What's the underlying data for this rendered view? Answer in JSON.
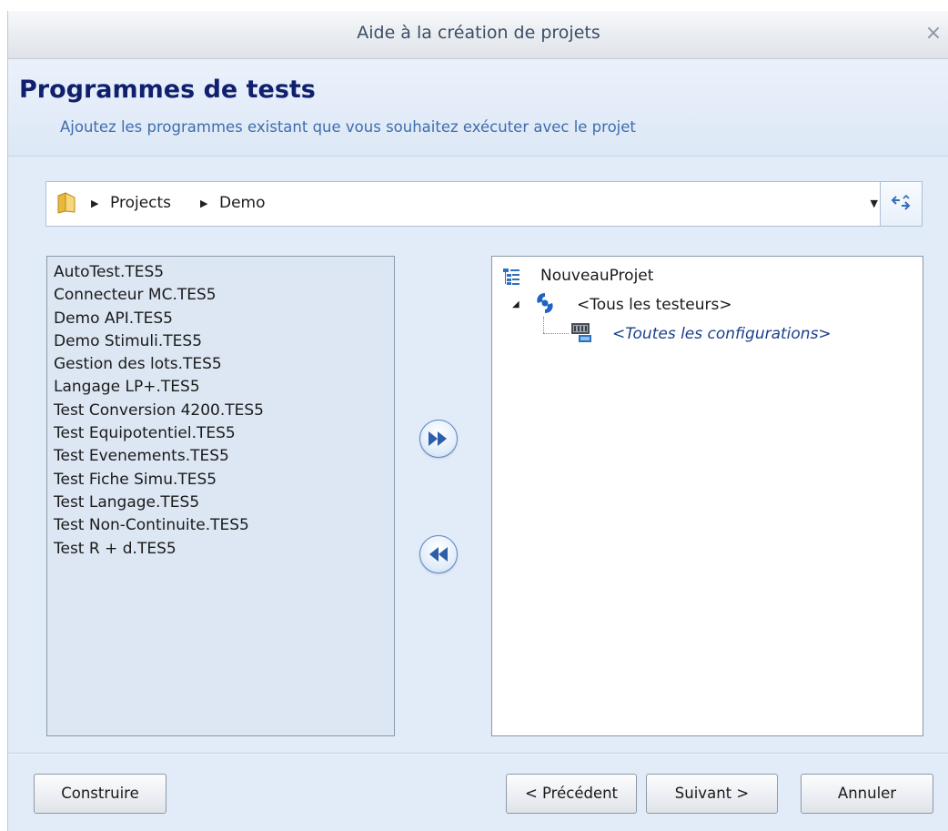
{
  "window": {
    "title": "Aide à la création de projets",
    "close_glyph": "×"
  },
  "header": {
    "title": "Programmes de tests",
    "subtitle": "Ajoutez les programmes existant que vous souhaitez exécuter avec le projet"
  },
  "path": {
    "icon": "folder-icon",
    "crumbs": [
      "Projects",
      "Demo"
    ],
    "refresh_icon": "refresh-icon"
  },
  "available_programs": [
    "AutoTest.TES5",
    "Connecteur MC.TES5",
    "Demo API.TES5",
    "Demo Stimuli.TES5",
    "Gestion des lots.TES5",
    "Langage LP+.TES5",
    "Test Conversion 4200.TES5",
    "Test Equipotentiel.TES5",
    "Test Evenements.TES5",
    "Test Fiche Simu.TES5",
    "Test Langage.TES5",
    "Test Non-Continuite.TES5",
    "Test R + d.TES5"
  ],
  "move_buttons": {
    "add_icon": "fast-forward-icon",
    "remove_icon": "rewind-icon"
  },
  "project_tree": {
    "root": {
      "label": "NouveauProjet",
      "icon": "tree-icon"
    },
    "tester": {
      "label": "<Tous les testeurs>",
      "icon": "tester-icon"
    },
    "config": {
      "label": "<Toutes les configurations>",
      "icon": "configuration-icon"
    }
  },
  "footer": {
    "build_label": "Construire",
    "previous_label": "< Précédent",
    "next_label": "Suivant >",
    "cancel_label": "Annuler"
  },
  "colors": {
    "title_text": "#10206e",
    "subtitle_text": "#3f6dab",
    "panel_background": "#e2ecf8",
    "left_list_background": "#dde7f4",
    "button_accent": "#2d5fa8"
  }
}
